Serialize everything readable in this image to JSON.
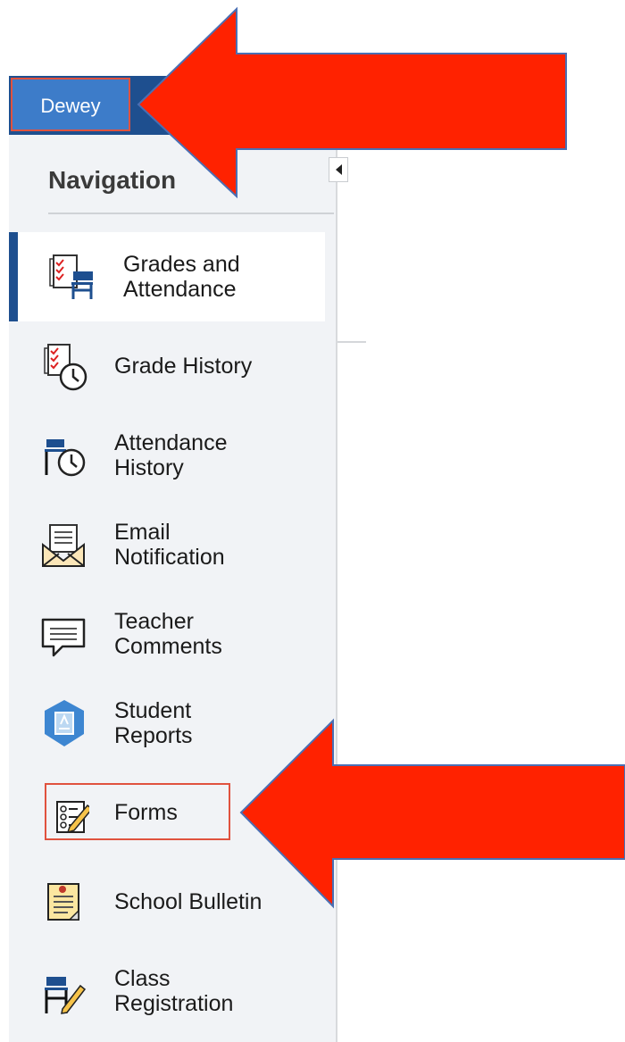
{
  "header": {
    "tab_label": "Dewey"
  },
  "sidebar": {
    "title": "Navigation",
    "items": [
      {
        "label": "Grades and\nAttendance",
        "icon": "grades-attendance-icon"
      },
      {
        "label": "Grade History",
        "icon": "grade-history-icon"
      },
      {
        "label": "Attendance\nHistory",
        "icon": "attendance-history-icon"
      },
      {
        "label": "Email\nNotification",
        "icon": "email-notification-icon"
      },
      {
        "label": "Teacher\nComments",
        "icon": "teacher-comments-icon"
      },
      {
        "label": "Student\nReports",
        "icon": "student-reports-icon"
      },
      {
        "label": "Forms",
        "icon": "forms-icon"
      },
      {
        "label": "School Bulletin",
        "icon": "school-bulletin-icon"
      },
      {
        "label": "Class\nRegistration",
        "icon": "class-registration-icon"
      }
    ]
  },
  "annotations": {
    "arrow_color": "#ff2200",
    "highlight_color": "#e0523e"
  }
}
